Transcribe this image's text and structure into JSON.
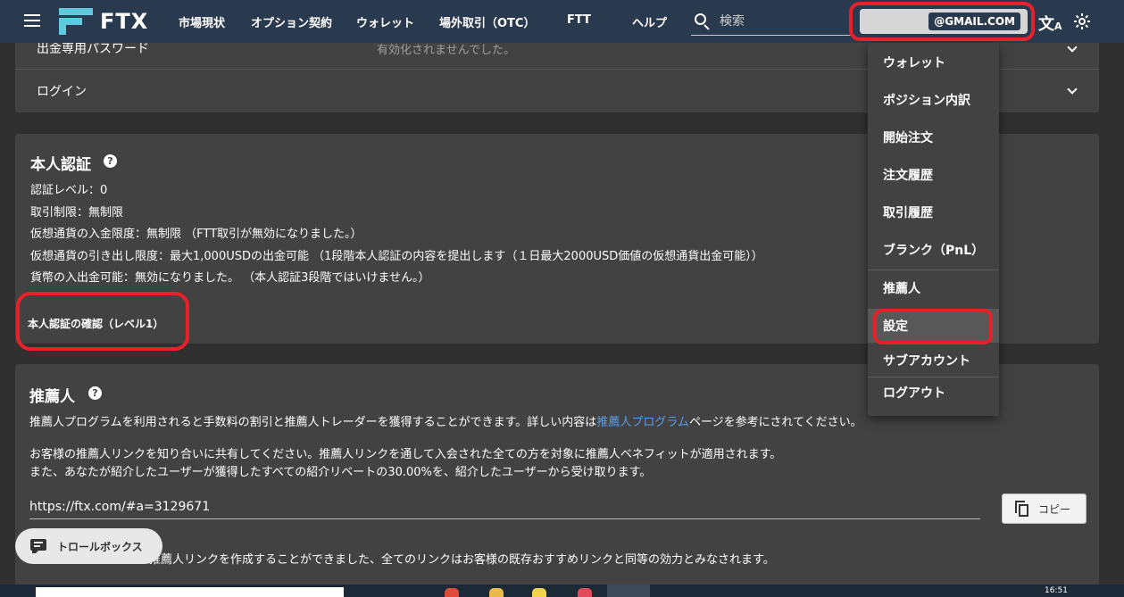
{
  "header": {
    "logo_text": "FTX",
    "nav": [
      {
        "label": "市場現状"
      },
      {
        "label": "オプション契約"
      },
      {
        "label": "ウォレット"
      },
      {
        "label": "場外取引（OTC）"
      },
      {
        "label": "FTT"
      },
      {
        "label": "ヘルプ"
      }
    ],
    "search_placeholder": "検索",
    "account_email": "@GMAIL.COM",
    "translate_icon": "translate-icon",
    "theme_icon": "brightness-icon"
  },
  "security": {
    "withdraw_password_label": "出金専用パスワード",
    "withdraw_password_value": "有効化されませんでした。",
    "login_label": "ログイン"
  },
  "kyc": {
    "title": "本人認証",
    "lines": [
      "認証レベル：0",
      "取引制限：無制限",
      "仮想通貨の入金限度：無制限 （FTT取引が無効になりました。）",
      "仮想通貨の引き出し限度：最大1,000USDの出金可能 （1段階本人認証の内容を提出します（１日最大2000USD価値の仮想通貨出金可能））",
      "貨幣の入出金可能：無効になりました。 （本人認証3段階ではいけません。）"
    ],
    "verify_link": "本人認証の確認（レベル1）"
  },
  "referral": {
    "title": "推薦人",
    "line1_prefix": "推薦人プログラムを利用されると手数料の割引と推薦人トレーダーを獲得することができます。詳しい内容は",
    "line1_link": "推薦人プログラム",
    "line1_suffix": "ページを参考にされてください。",
    "line2": "お客様の推薦人リンクを知り合いに共有してください。推薦人リンクを通して入会された全ての方を対象に推薦人ベネフィットが適用されます。",
    "line3": "また、あなたが紹介したユーザーが獲得したすべての紹介リベートの30.00%を、紹介したユーザーから受け取ります。",
    "url": "https://ftx.com/#a=3129671",
    "copy_label": "コピー",
    "line4": "推薦人リンクを作成することができました、全てのリンクはお客様の既存おすすめリンクと同等の効力とみなされます。"
  },
  "account_menu": {
    "items": [
      {
        "label": "ウォレット"
      },
      {
        "label": "ポジション内訳"
      },
      {
        "label": "開始注文"
      },
      {
        "label": "注文履歴"
      },
      {
        "label": "取引履歴"
      },
      {
        "label": "ブランク（PnL）"
      },
      {
        "label": "推薦人"
      },
      {
        "label": "設定"
      },
      {
        "label": "サブアカウント"
      },
      {
        "label": "ログアウト"
      }
    ],
    "active": "設定"
  },
  "trollbox": {
    "label": "トロールボックス"
  },
  "taskbar": {
    "clock": "16:51"
  },
  "colors": {
    "topbar": "#2a3a4e",
    "background": "#303030",
    "card": "#424242",
    "accent_logo": "#5fcade",
    "link": "#5c9ee6",
    "highlight_outline": "#e8202a"
  }
}
